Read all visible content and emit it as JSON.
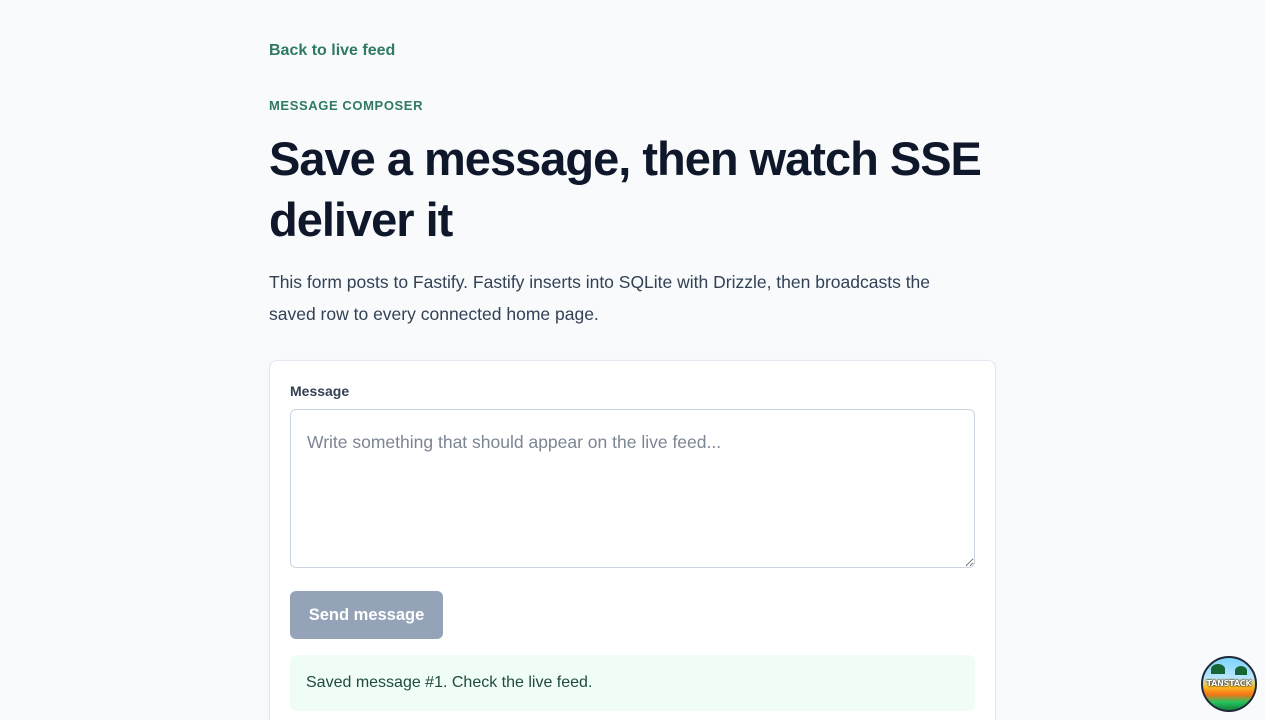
{
  "nav": {
    "back_link": "Back to live feed"
  },
  "header": {
    "eyebrow": "MESSAGE COMPOSER",
    "title": "Save a message, then watch SSE deliver it",
    "description": "This form posts to Fastify. Fastify inserts into SQLite with Drizzle, then broadcasts the saved row to every connected home page."
  },
  "form": {
    "message_label": "Message",
    "message_value": "",
    "message_placeholder": "Write something that should appear on the live feed...",
    "send_label": "Send message",
    "send_disabled": true,
    "status_text": "Saved message #1. Check the live feed."
  },
  "devtools": {
    "badge_text": "TANSTACK",
    "icon": "tanstack-devtools-icon"
  },
  "colors": {
    "accent": "#2f7a66",
    "button_disabled": "#94a3b8",
    "success_bg": "#f0fdf6"
  }
}
